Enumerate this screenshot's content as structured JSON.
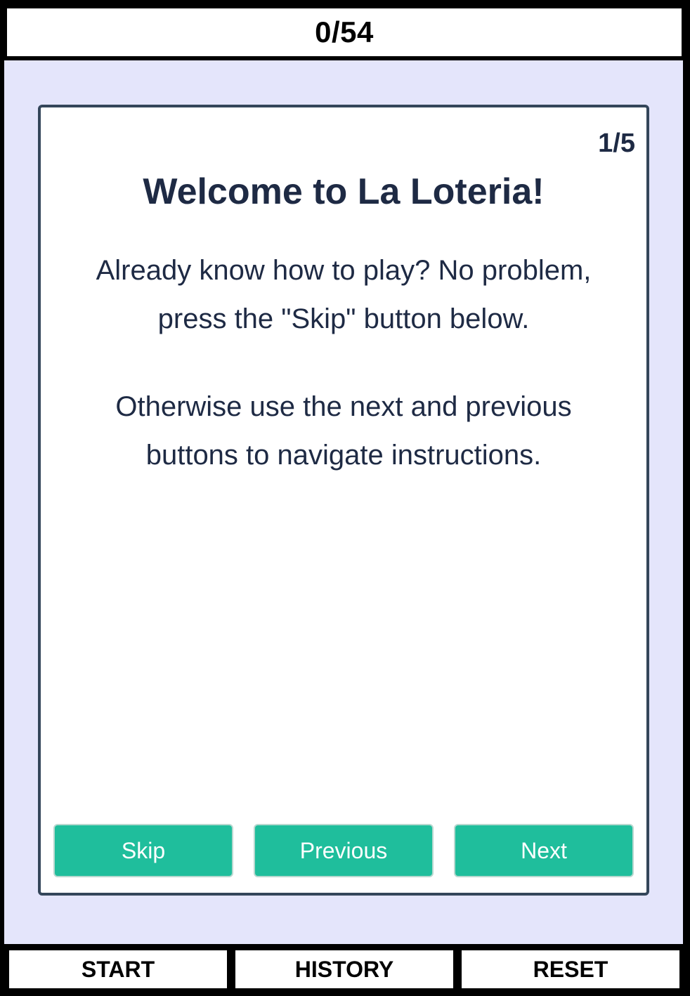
{
  "header": {
    "counter": "0/54"
  },
  "instructions": {
    "step": "1/5",
    "title": "Welcome to La Loteria!",
    "paragraphs": [
      "Already know how to play? No problem, press the \"Skip\" button below.",
      "Otherwise use the next and previous buttons to navigate instructions."
    ],
    "buttons": {
      "skip": "Skip",
      "previous": "Previous",
      "next": "Next"
    }
  },
  "nav": {
    "start": "START",
    "history": "HISTORY",
    "reset": "RESET"
  },
  "colors": {
    "background": "#e4e5fb",
    "card_border": "#34465a",
    "text": "#1e2a44",
    "button": "#1fbe9c"
  }
}
